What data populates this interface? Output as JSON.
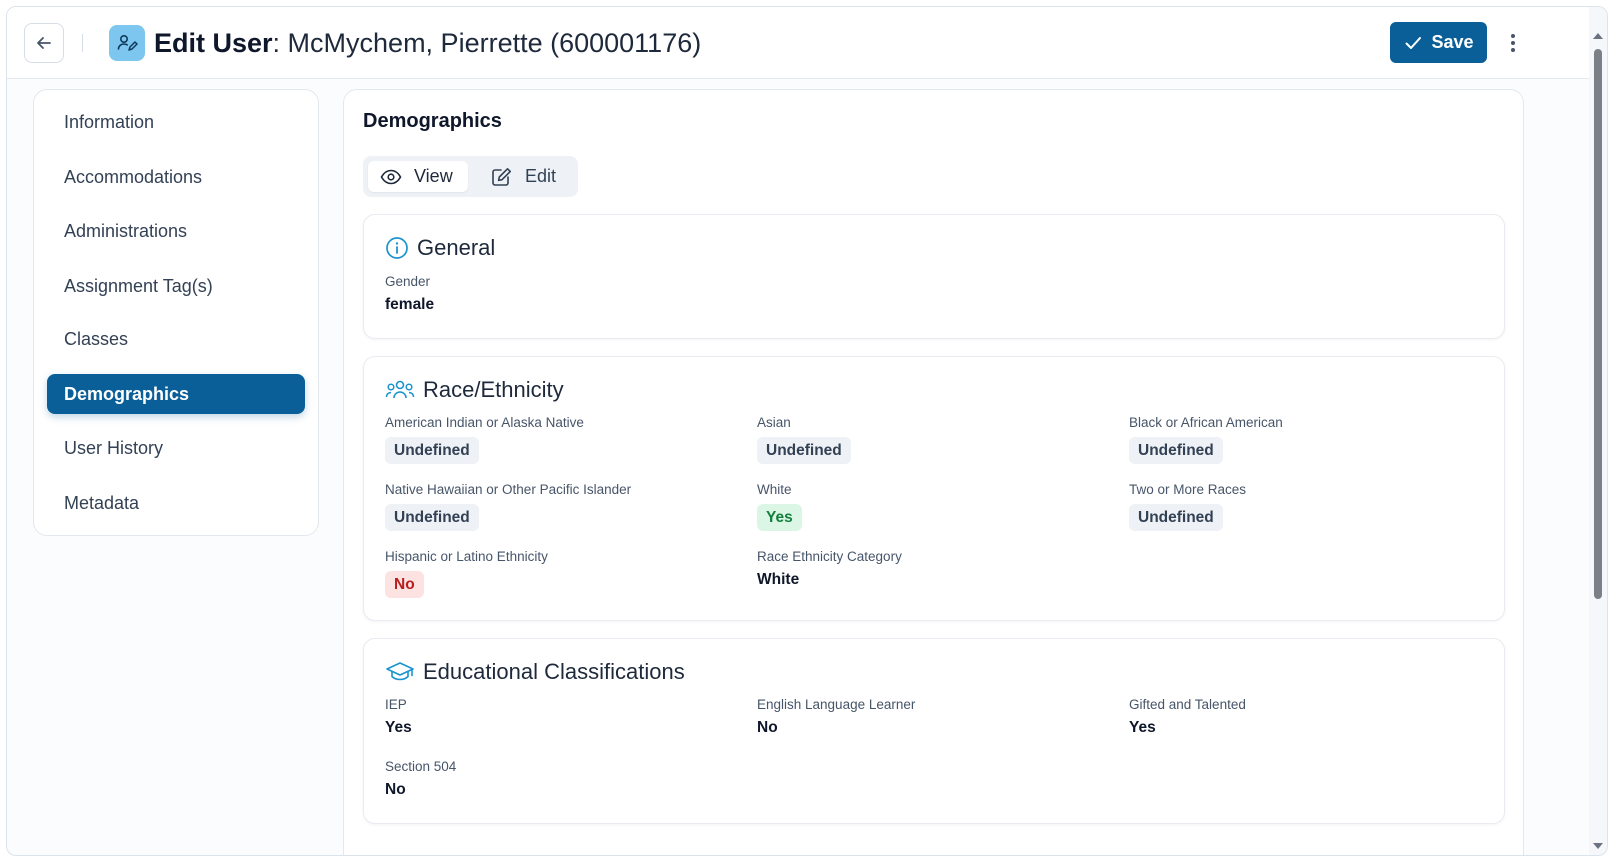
{
  "header": {
    "title_bold": "Edit User",
    "title_rest": ": McMychem, Pierrette (600001176)",
    "save_label": "Save"
  },
  "sidebar": {
    "items": [
      {
        "label": "Information"
      },
      {
        "label": "Accommodations"
      },
      {
        "label": "Administrations"
      },
      {
        "label": "Assignment Tag(s)"
      },
      {
        "label": "Classes"
      },
      {
        "label": "Demographics",
        "active": true
      },
      {
        "label": "User History"
      },
      {
        "label": "Metadata"
      }
    ]
  },
  "main": {
    "title": "Demographics",
    "view_label": "View",
    "edit_label": "Edit",
    "general": {
      "title": "General",
      "gender_label": "Gender",
      "gender_value": "female"
    },
    "race": {
      "title": "Race/Ethnicity",
      "fields": [
        {
          "label": "American Indian or Alaska Native",
          "value": "Undefined"
        },
        {
          "label": "Asian",
          "value": "Undefined"
        },
        {
          "label": "Black or African American",
          "value": "Undefined"
        },
        {
          "label": "Native Hawaiian or Other Pacific Islander",
          "value": "Undefined"
        },
        {
          "label": "White",
          "value": "Yes"
        },
        {
          "label": "Two or More Races",
          "value": "Undefined"
        },
        {
          "label": "Hispanic or Latino Ethnicity",
          "value": "No"
        },
        {
          "label": "Race Ethnicity Category",
          "value": "White"
        }
      ]
    },
    "education": {
      "title": "Educational Classifications",
      "fields": [
        {
          "label": "IEP",
          "value": "Yes"
        },
        {
          "label": "English Language Learner",
          "value": "No"
        },
        {
          "label": "Gifted and Talented",
          "value": "Yes"
        },
        {
          "label": "Section 504",
          "value": "No"
        }
      ]
    }
  },
  "colors": {
    "primary": "#0a5f98",
    "icon_accent": "#1a93cf",
    "badge_yes": "#dcf6e5",
    "badge_no": "#fde2e2",
    "badge_undefined": "#eef1f5"
  },
  "icons": {
    "back": "arrow-left-icon",
    "title": "user-edit-icon",
    "save": "check-icon",
    "menu": "kebab-menu-icon",
    "view": "eye-icon",
    "edit": "pencil-square-icon",
    "general": "info-circle-icon",
    "race": "users-group-icon",
    "education": "graduation-cap-icon"
  }
}
